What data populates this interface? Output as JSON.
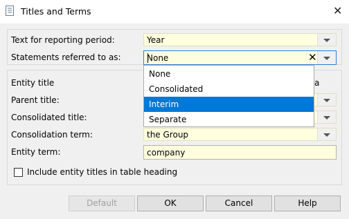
{
  "window": {
    "title": "Titles and Terms",
    "title_icon": "document-icon",
    "close_icon": "close-icon"
  },
  "top_section": {
    "reporting_period": {
      "label": "Text for reporting period:",
      "value": "Year"
    },
    "statements": {
      "label": "Statements referred to as:",
      "value": "None",
      "clear_icon": "clear-icon"
    }
  },
  "bottom_section": {
    "entity_title": {
      "label": "Entity title",
      "peek": "a"
    },
    "parent_title": {
      "label": "Parent title:"
    },
    "consolidated_title": {
      "label": "Consolidated title:"
    },
    "consolidation_term": {
      "label": "Consolidation term:",
      "value": "the Group"
    },
    "entity_term": {
      "label": "Entity term:",
      "value": "company"
    },
    "include_titles": {
      "label": "Include entity titles in table heading",
      "checked": false
    }
  },
  "dropdown": {
    "options": [
      "None",
      "Consolidated",
      "Interim",
      "Separate"
    ],
    "highlighted": "Interim"
  },
  "buttons": {
    "default": "Default",
    "ok": "OK",
    "cancel": "Cancel",
    "help": "Help"
  },
  "colors": {
    "field_bg": "#ffffe0",
    "selection": "#0078d7",
    "focus_border": "#2e7bd6"
  }
}
